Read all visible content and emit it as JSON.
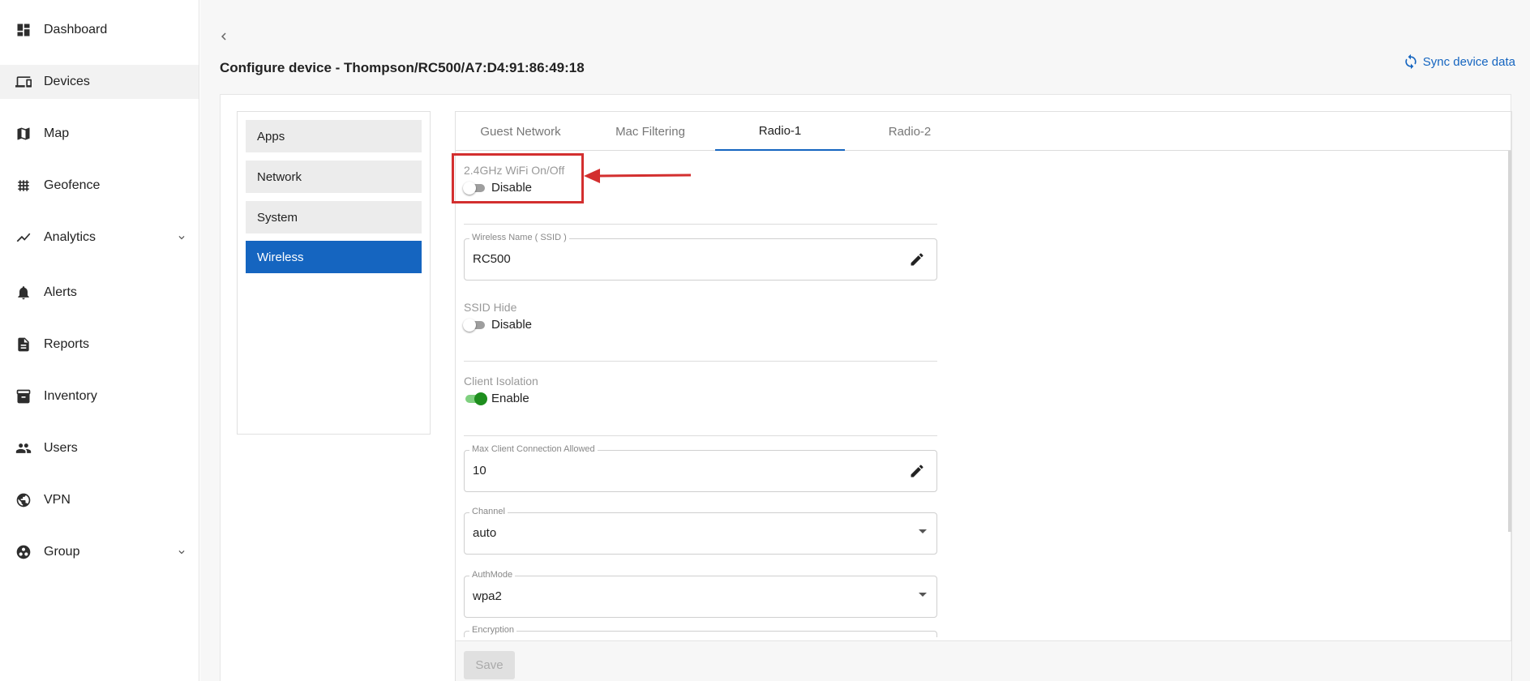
{
  "sidebar": {
    "items": [
      {
        "label": "Dashboard",
        "icon": "dashboard-icon"
      },
      {
        "label": "Devices",
        "icon": "devices-icon"
      },
      {
        "label": "Map",
        "icon": "map-icon"
      },
      {
        "label": "Geofence",
        "icon": "geofence-icon"
      },
      {
        "label": "Analytics",
        "icon": "analytics-icon",
        "expandable": true
      },
      {
        "label": "Alerts",
        "icon": "bell-icon"
      },
      {
        "label": "Reports",
        "icon": "reports-icon"
      },
      {
        "label": "Inventory",
        "icon": "archive-icon"
      },
      {
        "label": "Users",
        "icon": "users-icon"
      },
      {
        "label": "VPN",
        "icon": "vpn-icon"
      },
      {
        "label": "Group",
        "icon": "group-icon",
        "expandable": true
      }
    ],
    "active": "Devices"
  },
  "header": {
    "title": "Configure device - Thompson/RC500/A7:D4:91:86:49:18",
    "sync_label": "Sync device data"
  },
  "left_menu": {
    "items": [
      "Apps",
      "Network",
      "System",
      "Wireless"
    ],
    "active": "Wireless"
  },
  "tabs": {
    "items": [
      "Guest Network",
      "Mac Filtering",
      "Radio-1",
      "Radio-2"
    ],
    "active": "Radio-1"
  },
  "form": {
    "wifi": {
      "label": "2.4GHz WiFi On/Off",
      "state": "Disable",
      "on": false
    },
    "ssid": {
      "label": "Wireless Name ( SSID )",
      "value": "RC500"
    },
    "ssid_hide": {
      "label": "SSID Hide",
      "state": "Disable",
      "on": false
    },
    "client_isolation": {
      "label": "Client Isolation",
      "state": "Enable",
      "on": true
    },
    "max_clients": {
      "label": "Max Client Connection Allowed",
      "value": "10"
    },
    "channel": {
      "label": "Channel",
      "value": "auto"
    },
    "authmode": {
      "label": "AuthMode",
      "value": "wpa2"
    },
    "encryption": {
      "label": "Encryption"
    }
  },
  "save_label": "Save",
  "colors": {
    "accent": "#1565c0",
    "annotation": "#d32f2f",
    "toggle_on": "#1e8e1e"
  }
}
